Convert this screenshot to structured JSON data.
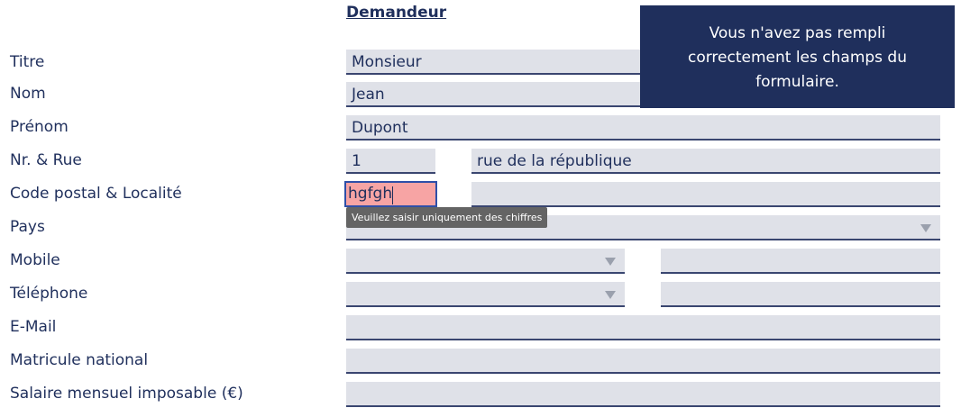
{
  "section": {
    "title": "Demandeur"
  },
  "labels": {
    "titre": "Titre",
    "nom": "Nom",
    "prenom": "Prénom",
    "rue": "Nr. & Rue",
    "cp": "Code postal & Localité",
    "pays": "Pays",
    "mobile": "Mobile",
    "telephone": "Téléphone",
    "email": "E-Mail",
    "matricule": "Matricule national",
    "salaire": "Salaire mensuel imposable (€)"
  },
  "values": {
    "titre": "Monsieur",
    "nom": "Jean",
    "prenom": "Dupont",
    "numero": "1",
    "rue": "rue de la république",
    "code_postal": "hgfgh",
    "localite": "",
    "pays": "",
    "mobile_prefix": "",
    "mobile_number": "",
    "telephone_prefix": "",
    "telephone_number": "",
    "email": "",
    "matricule": "",
    "salaire": ""
  },
  "tooltip": {
    "text": "Veuillez saisir uniquement des chiffres"
  },
  "alert": {
    "message": "Vous n'avez pas rempli correctement les champs du formulaire."
  },
  "colors": {
    "text": "#1f2f5c",
    "field_bg": "#dfe1e8",
    "error_bg": "#f7a4a4",
    "alert_bg": "#1f2f5c",
    "tooltip_bg": "#646464"
  }
}
